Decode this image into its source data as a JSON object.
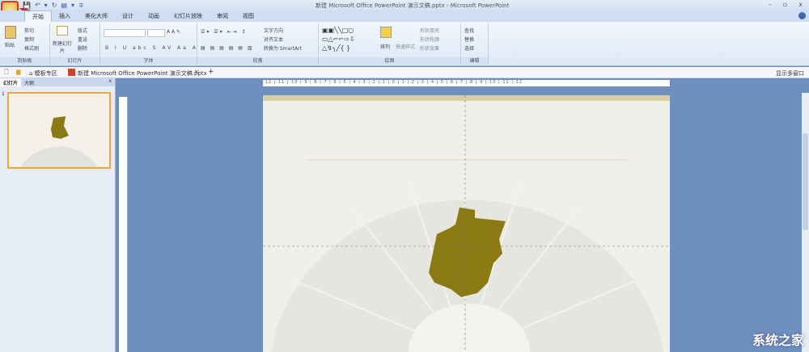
{
  "window": {
    "title": "新建 Microsoft Office PowerPoint 演示文稿.pptx - Microsoft PowerPoint",
    "minimize": "–",
    "restore": "▫",
    "close": "x"
  },
  "qat": [
    "💾",
    "↶",
    "▾",
    "↻",
    "▤",
    "▾",
    "∓"
  ],
  "tabs": [
    "开始",
    "插入",
    "美化大师",
    "设计",
    "动画",
    "幻灯片放映",
    "审阅",
    "视图"
  ],
  "ribbon": {
    "clipboard": {
      "label": "剪贴板",
      "paste": "粘贴",
      "cut": "剪切",
      "copy": "复制",
      "format_painter": "格式刷"
    },
    "slides": {
      "label": "幻灯片",
      "new_slide": "新建幻灯片",
      "layout": "版式",
      "reset": "重设",
      "delete": "删除"
    },
    "font": {
      "label": "字体",
      "font_name": "",
      "font_size": ""
    },
    "paragraph": {
      "label": "段落",
      "text_direction": "文字方向",
      "align_text": "对齐文本",
      "smartart": "转换为 SmartArt"
    },
    "drawing": {
      "label": "绘图",
      "arrange": "排列",
      "quick_styles": "快速样式",
      "shape_fill": "形状填充",
      "shape_outline": "形状轮廓",
      "shape_effects": "形状效果"
    },
    "editing": {
      "label": "编辑",
      "find": "查找",
      "replace": "替换",
      "select": "选择"
    }
  },
  "doctabs": {
    "templates": "模板专区",
    "document": "新建 Microsoft Office PowerPoint 演示文稿.pptx",
    "close": "×",
    "add": "+",
    "multi_window": "显示多窗口"
  },
  "leftpanel": {
    "tabs": [
      "幻灯片",
      "大纲"
    ],
    "close": "x",
    "slide_number": "1"
  },
  "ruler": "·12·|·11·|·10·|·9·|·8·|·7·|·6·|·5·|·4·|·3·|·2·|·1·|·0·|·1·|·2·|·3·|·4·|·5·|·6·|·7·|·8·|·9·|·10·|·11·|·12·",
  "watermark": "系统之家"
}
